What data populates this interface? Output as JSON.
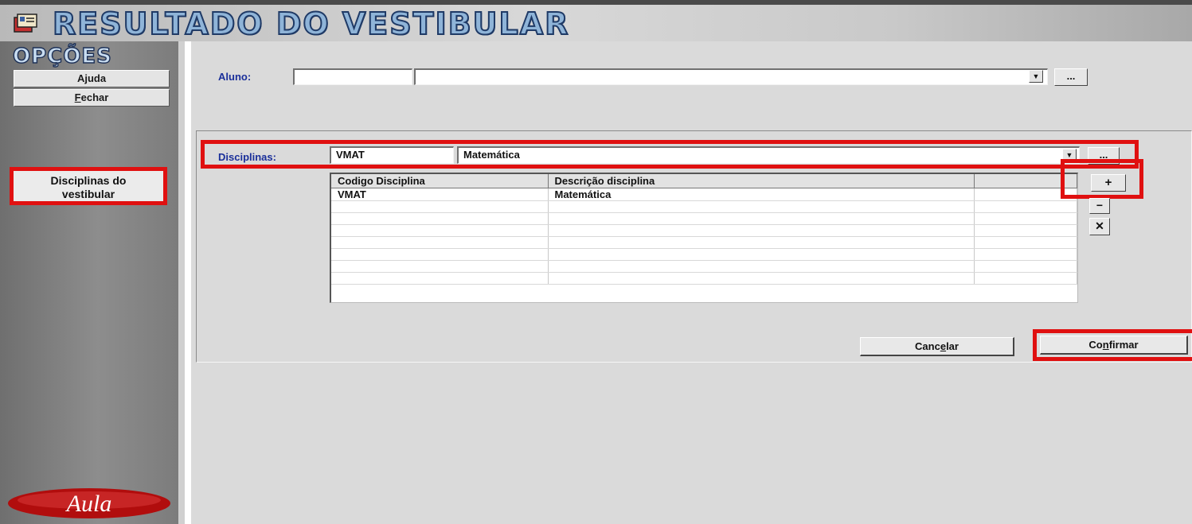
{
  "window": {
    "title": "RESULTADO DO VESTIBULAR"
  },
  "sidebar": {
    "heading": "OPÇÕES",
    "buttons": [
      {
        "label": "Ajuda"
      },
      {
        "label": "echar",
        "accel": "F"
      }
    ],
    "module": {
      "line1": "Disciplinas do",
      "line2": "vestibular"
    },
    "logo_text": "Aula"
  },
  "aluno": {
    "label": "Aluno:",
    "code_value": "",
    "name_value": "",
    "lookup_label": "..."
  },
  "disciplinas": {
    "label": "Disciplinas:",
    "code_value": "VMAT",
    "name_value": "Matemática",
    "lookup_label": "..."
  },
  "grid": {
    "headers": [
      "Codigo Disciplina",
      "Descrição disciplina",
      ""
    ],
    "rows": [
      [
        "VMAT",
        "Matemática",
        ""
      ],
      [
        "",
        "",
        ""
      ],
      [
        "",
        "",
        ""
      ],
      [
        "",
        "",
        ""
      ],
      [
        "",
        "",
        ""
      ],
      [
        "",
        "",
        ""
      ],
      [
        "",
        "",
        ""
      ],
      [
        "",
        "",
        ""
      ]
    ]
  },
  "grid_buttons": {
    "add": "+",
    "remove": "−",
    "clear": "✕"
  },
  "actions": {
    "cancel": {
      "pre": "Canc",
      "accel": "e",
      "post": "lar"
    },
    "confirm": {
      "pre": "Co",
      "accel": "n",
      "post": "firmar"
    }
  },
  "colors": {
    "highlight": "#e01010",
    "label_blue": "#1a2f9a",
    "sidebar": "#7c7c7c"
  }
}
